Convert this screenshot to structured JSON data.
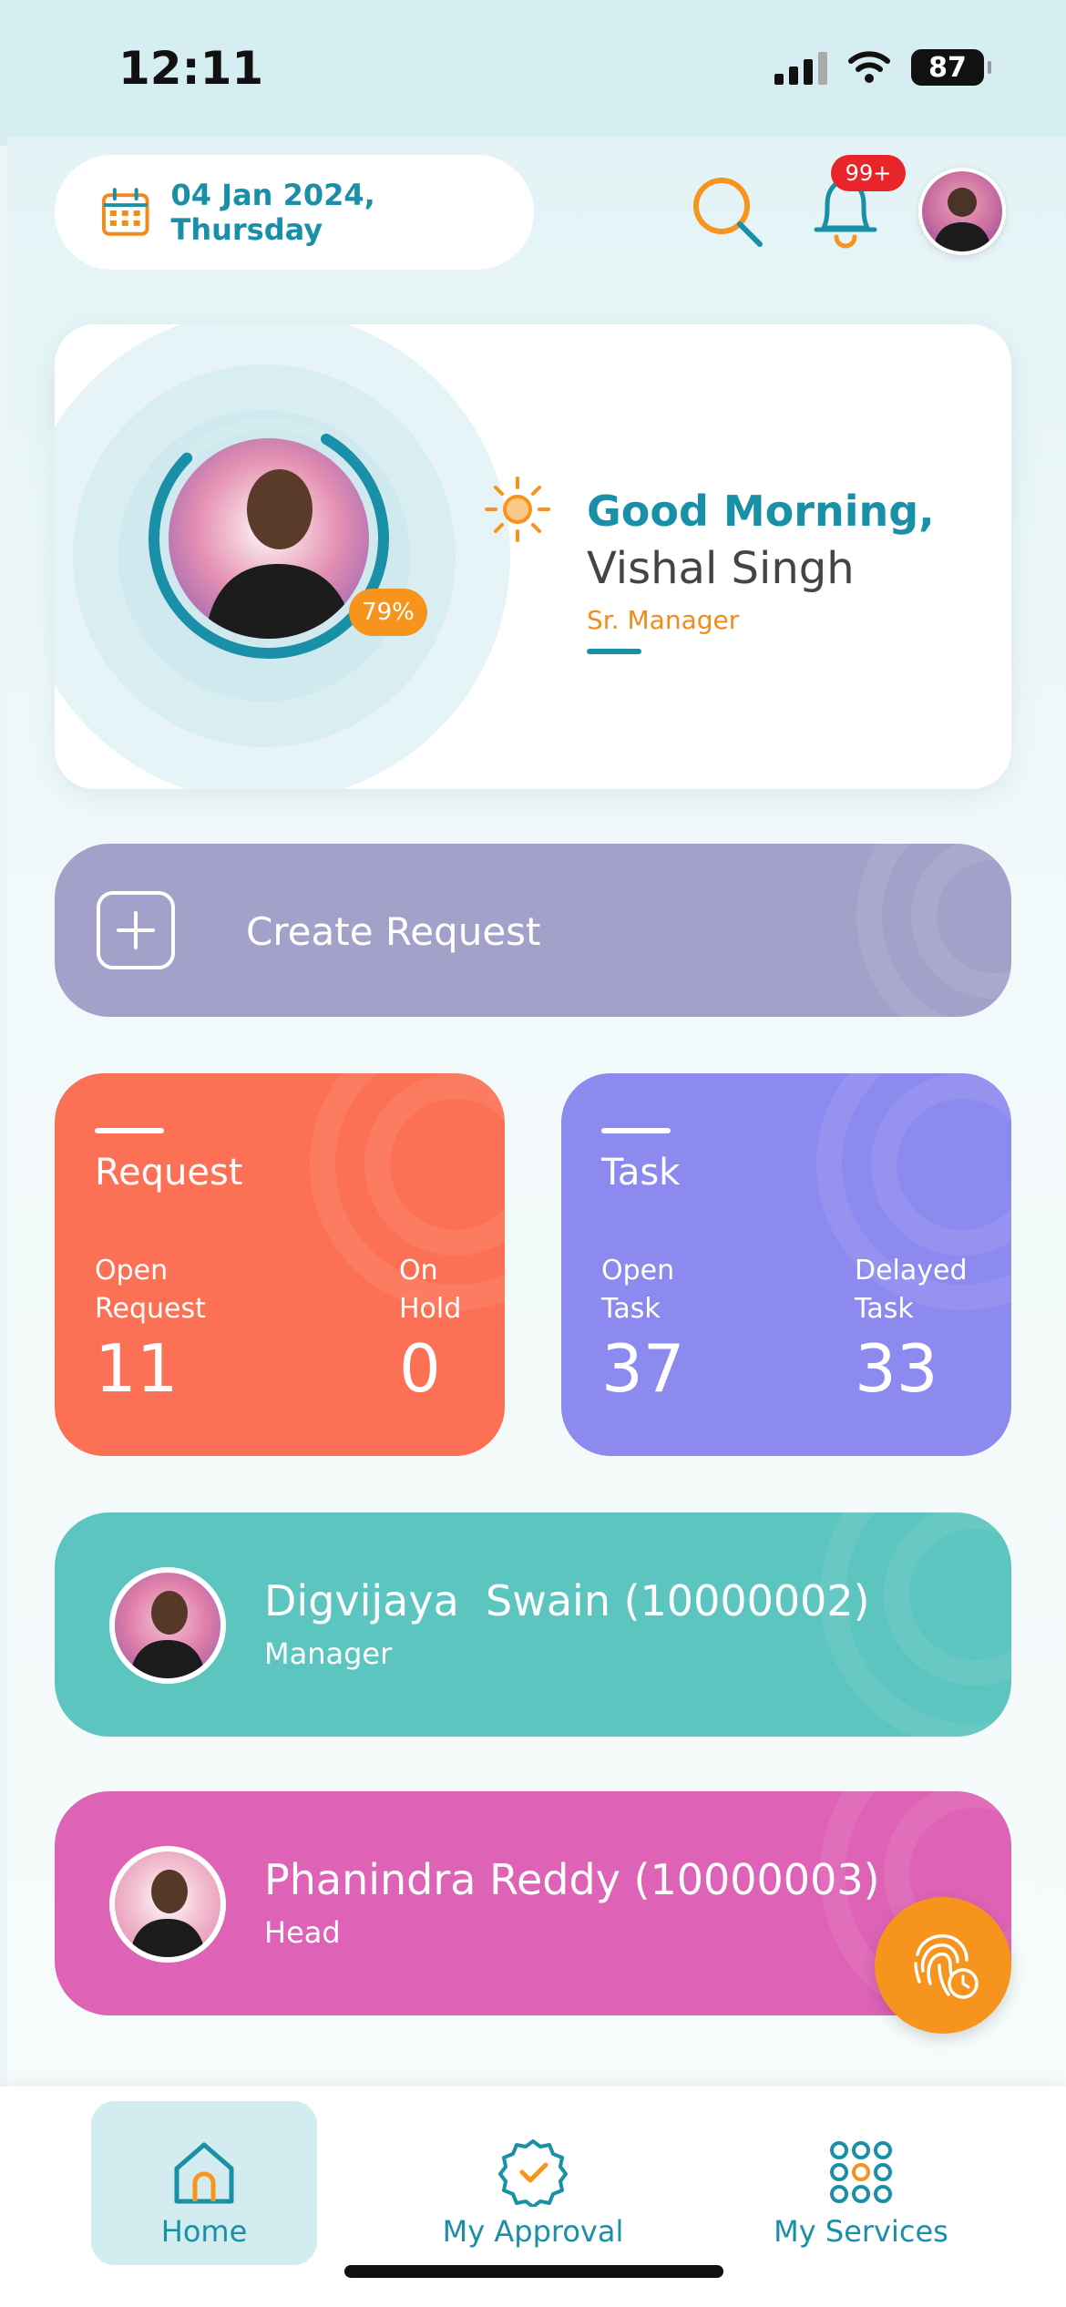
{
  "status_bar": {
    "time": "12:11",
    "battery": "87"
  },
  "header": {
    "date": "04 Jan 2024, Thursday",
    "notification_badge": "99+",
    "icons": [
      "calendar-icon",
      "search-icon",
      "bell-icon"
    ]
  },
  "profile": {
    "greeting": "Good Morning,",
    "name": "Vishal Singh",
    "role": "Sr. Manager",
    "completion": "79%",
    "completion_value": 0.79
  },
  "create_request": {
    "label": "Create Request"
  },
  "stats": {
    "request": {
      "title": "Request",
      "left_label": "Open\nRequest",
      "left_value": "11",
      "right_label": "On\nHold",
      "right_value": "0"
    },
    "task": {
      "title": "Task",
      "left_label": "Open\nTask",
      "left_value": "37",
      "right_label": "Delayed\nTask",
      "right_value": "33"
    }
  },
  "people": [
    {
      "name": "Digvijaya  Swain (10000002)",
      "role": "Manager"
    },
    {
      "name": "Phanindra Reddy (10000003)",
      "role": "Head"
    }
  ],
  "nav": {
    "items": [
      {
        "label": "Home",
        "icon": "home-icon",
        "active": true
      },
      {
        "label": "My Approval",
        "icon": "approval-badge-icon",
        "active": false
      },
      {
        "label": "My Services",
        "icon": "grid-dots-icon",
        "active": false
      }
    ]
  },
  "colors": {
    "accent": "#1a8fa8",
    "orange": "#f7941d",
    "request_card": "#fc7155",
    "task_card": "#8c8aee",
    "create_button": "#a3a1c9",
    "manager_card": "#5cc5bf",
    "head_card": "#de62b6"
  }
}
